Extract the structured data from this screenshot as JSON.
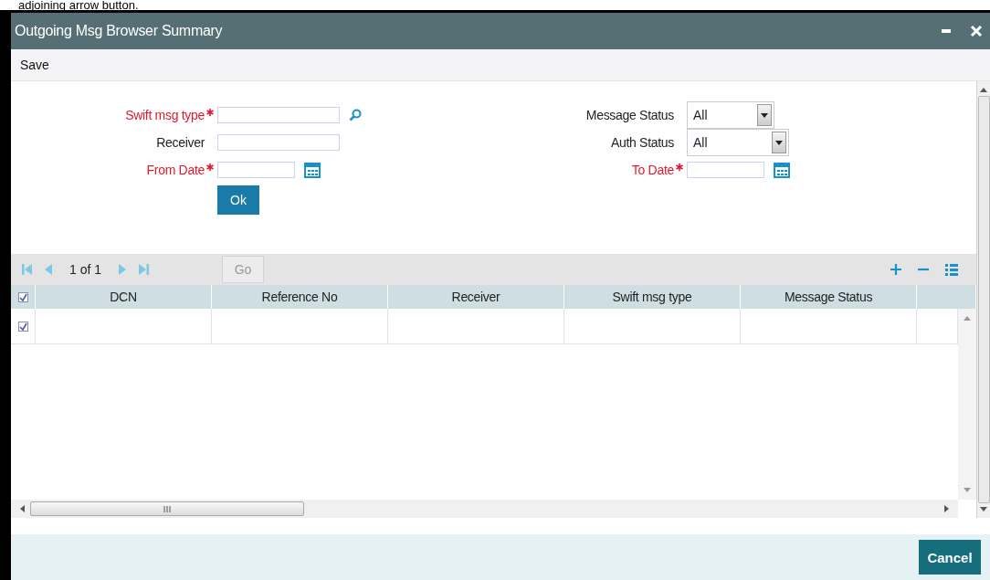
{
  "caption": "adjoining arrow button.",
  "window": {
    "title": "Outgoing Msg Browser Summary"
  },
  "toolbar": [
    "Save"
  ],
  "form_left": [
    {
      "kind": "lookup",
      "label": "Swift msg type",
      "required": true
    },
    {
      "kind": "text",
      "label": "Receiver",
      "required": false
    },
    {
      "kind": "date",
      "label": "From Date",
      "required": true
    }
  ],
  "ok_button": "Ok",
  "form_right": [
    {
      "kind": "select",
      "label": "Message Status",
      "required": false,
      "value": "All"
    },
    {
      "kind": "select",
      "label": "Auth Status",
      "required": false,
      "value": "All"
    },
    {
      "kind": "date",
      "label": "To Date",
      "required": true
    }
  ],
  "pager": {
    "page": "1 of 1",
    "go": "Go"
  },
  "table": {
    "header_checked": true,
    "columns": [
      "DCN",
      "Reference No",
      "Receiver",
      "Swift msg type",
      "Message Status"
    ],
    "rows": [
      {
        "checked": true
      }
    ]
  },
  "footer_buttons": [
    "Cancel"
  ]
}
